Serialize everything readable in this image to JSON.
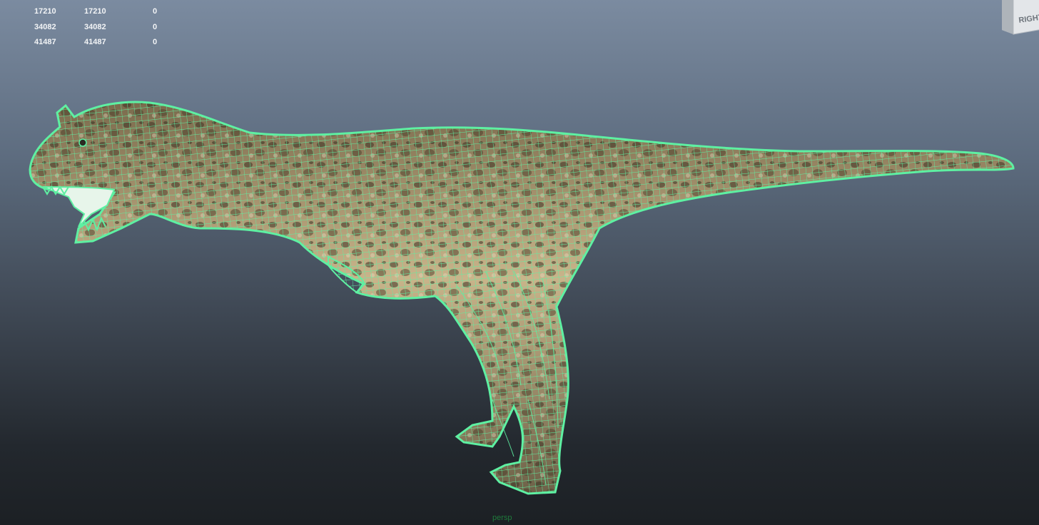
{
  "hud": {
    "rows": [
      {
        "a": "17210",
        "b": "17210",
        "c": "0"
      },
      {
        "a": "34082",
        "b": "34082",
        "c": "0"
      },
      {
        "a": "41487",
        "b": "41487",
        "c": "0"
      }
    ]
  },
  "viewcube": {
    "face_label": "RIGHT"
  },
  "camera": {
    "label": "persp"
  },
  "colors": {
    "wireframe": "#5ef0a2",
    "background_top": "#7b8ba0",
    "background_bottom": "#1c2024",
    "hud_text": "#f2f4f6",
    "camera_label": "#1f7a3c"
  }
}
